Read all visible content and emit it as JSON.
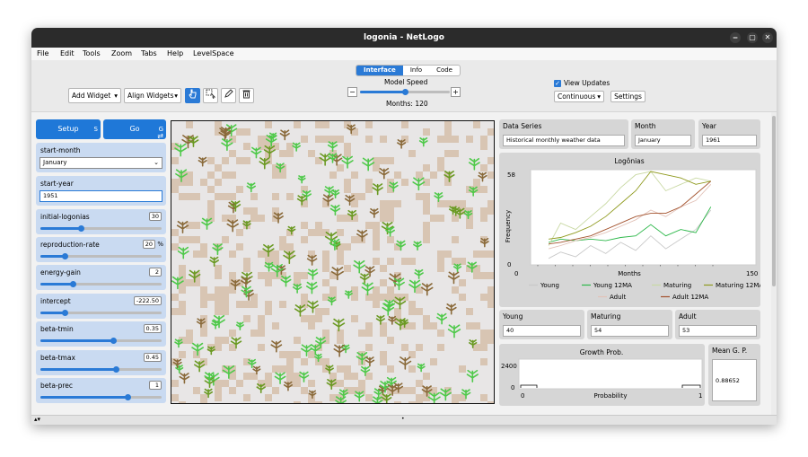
{
  "window": {
    "title": "logonia - NetLogo",
    "controls": [
      "‒",
      "▢",
      "✕"
    ]
  },
  "menu": [
    "File",
    "Edit",
    "Tools",
    "Zoom",
    "Tabs",
    "Help",
    "LevelSpace"
  ],
  "tabs": [
    {
      "label": "Interface",
      "active": true
    },
    {
      "label": "Info",
      "active": false
    },
    {
      "label": "Code",
      "active": false
    }
  ],
  "toolbar": {
    "add_widget": "Add Widget",
    "align_widgets": "Align Widgets",
    "model_speed_label": "Model Speed",
    "months_label": "Months: 120",
    "speed_minus": "−",
    "speed_plus": "+",
    "speed_level": 0.5,
    "view_updates_label": "View Updates",
    "view_updates_checked": true,
    "update_mode": "Continuous",
    "settings": "Settings",
    "icons": [
      "pointer-icon",
      "select-icon",
      "edit-icon",
      "delete-icon"
    ]
  },
  "buttons": {
    "setup": {
      "label": "Setup",
      "key": "S"
    },
    "go": {
      "label": "Go",
      "key": "G"
    }
  },
  "start_month": {
    "label": "start-month",
    "value": "January"
  },
  "start_year": {
    "label": "start-year",
    "value": "1951"
  },
  "sliders": [
    {
      "label": "initial-logonias",
      "value": "30",
      "unit": "",
      "fraction": 0.33
    },
    {
      "label": "reproduction-rate",
      "value": "20",
      "unit": "%",
      "fraction": 0.2
    },
    {
      "label": "energy-gain",
      "value": "2",
      "unit": "",
      "fraction": 0.27
    },
    {
      "label": "intercept",
      "value": "-222.50",
      "unit": "",
      "fraction": 0.2
    },
    {
      "label": "beta-tmin",
      "value": "0.35",
      "unit": "",
      "fraction": 0.6
    },
    {
      "label": "beta-tmax",
      "value": "0.45",
      "unit": "",
      "fraction": 0.62
    },
    {
      "label": "beta-prec",
      "value": "1",
      "unit": "",
      "fraction": 0.72
    }
  ],
  "data_series": {
    "label": "Data Series",
    "value": "Historical monthly weather data"
  },
  "month": {
    "label": "Month",
    "value": "January"
  },
  "year": {
    "label": "Year",
    "value": "1961"
  },
  "logonias_plot": {
    "title": "Logônias",
    "ylabel": "Frequency",
    "xlabel": "Months",
    "ymax_label": "58",
    "ymin_label": "0",
    "xmin_label": "0",
    "xmax_label": "150",
    "legend": [
      {
        "name": "Young",
        "color": "#c8c8c8"
      },
      {
        "name": "Young 12MA",
        "color": "#2db84a"
      },
      {
        "name": "Maturing",
        "color": "#c9d9a4"
      },
      {
        "name": "Maturing 12MA",
        "color": "#8f9a1e"
      },
      {
        "name": "Adult",
        "color": "#e2c2b8"
      },
      {
        "name": "Adult 12MA",
        "color": "#a3522d"
      }
    ]
  },
  "chart_data": {
    "type": "line",
    "title": "Logônias",
    "xlabel": "Months",
    "ylabel": "Frequency",
    "xlim": [
      0,
      150
    ],
    "ylim": [
      0,
      58
    ],
    "series": [
      {
        "name": "Young",
        "color": "#c8c8c8",
        "x": [
          12,
          20,
          30,
          40,
          50,
          60,
          70,
          80,
          90,
          100,
          110,
          120
        ],
        "values": [
          4,
          8,
          5,
          12,
          7,
          14,
          9,
          18,
          10,
          16,
          22,
          34
        ]
      },
      {
        "name": "Young 12MA",
        "color": "#2db84a",
        "x": [
          12,
          20,
          30,
          40,
          50,
          60,
          70,
          80,
          90,
          100,
          110,
          120
        ],
        "values": [
          14,
          16,
          15,
          16,
          15,
          17,
          18,
          25,
          18,
          22,
          20,
          36
        ]
      },
      {
        "name": "Maturing",
        "color": "#c9d9a4",
        "x": [
          12,
          20,
          30,
          40,
          50,
          60,
          70,
          80,
          90,
          100,
          110,
          120
        ],
        "values": [
          12,
          26,
          22,
          30,
          38,
          48,
          56,
          58,
          46,
          50,
          54,
          52
        ]
      },
      {
        "name": "Maturing 12MA",
        "color": "#8f9a1e",
        "x": [
          12,
          20,
          30,
          40,
          50,
          60,
          70,
          80,
          90,
          100,
          110,
          120
        ],
        "values": [
          16,
          17,
          20,
          24,
          30,
          38,
          46,
          58,
          56,
          54,
          50,
          52
        ]
      },
      {
        "name": "Adult",
        "color": "#e2c2b8",
        "x": [
          12,
          20,
          30,
          40,
          50,
          60,
          70,
          80,
          90,
          100,
          110,
          120
        ],
        "values": [
          10,
          12,
          15,
          17,
          20,
          24,
          28,
          34,
          30,
          36,
          40,
          50
        ]
      },
      {
        "name": "Adult 12MA",
        "color": "#a3522d",
        "x": [
          12,
          20,
          30,
          40,
          50,
          60,
          70,
          80,
          90,
          100,
          110,
          120
        ],
        "values": [
          13,
          14,
          16,
          18,
          22,
          26,
          30,
          32,
          32,
          36,
          44,
          52
        ]
      }
    ]
  },
  "counts": {
    "young": {
      "label": "Young",
      "value": "40"
    },
    "maturing": {
      "label": "Maturing",
      "value": "54"
    },
    "adult": {
      "label": "Adult",
      "value": "53"
    }
  },
  "growth_plot": {
    "title": "Growth Prob.",
    "xlabel": "Probability",
    "ymax_label": "2400",
    "ymin_label": "0",
    "xmin_label": "0",
    "xmax_label": "1"
  },
  "mean_gp": {
    "label": "Mean G. P.",
    "value": "0.88652"
  },
  "colors": {
    "accent": "#2a7ad6",
    "widget_bg": "#c9daf1",
    "patch": "#d8c5b3",
    "young_plant": "#4fc94a",
    "mature_plant": "#6b9a23",
    "adult_plant": "#8a6a3a"
  }
}
